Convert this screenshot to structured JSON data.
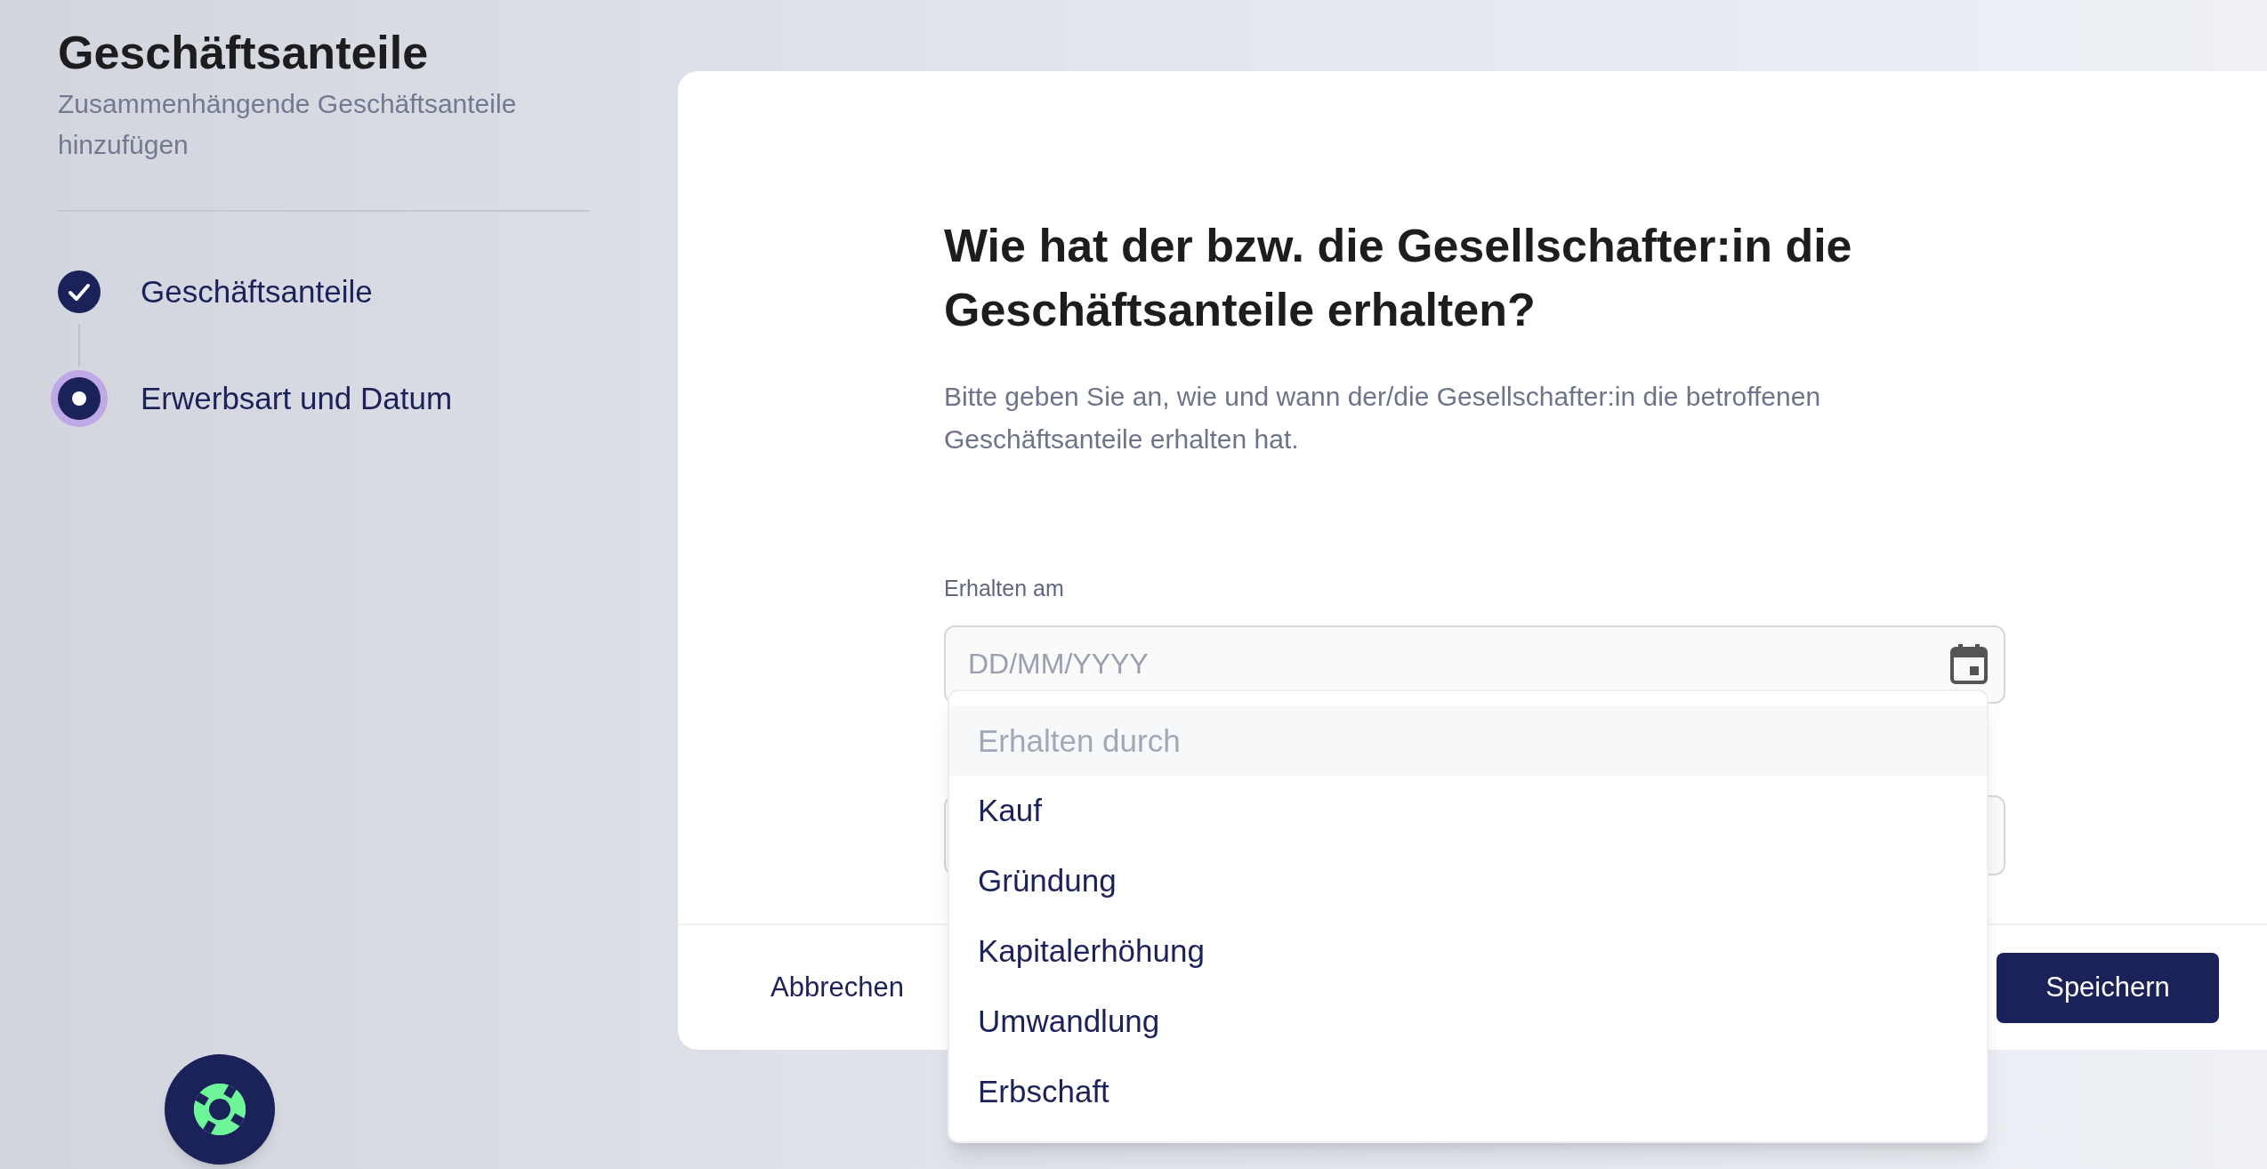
{
  "sidebar": {
    "title": "Geschäftsanteile",
    "subtitle": "Zusammenhängende Geschäftsanteile hinzufügen",
    "steps": [
      {
        "label": "Geschäftsanteile",
        "kind": "done"
      },
      {
        "label": "Erwerbsart und Datum",
        "kind": "current"
      }
    ]
  },
  "form": {
    "heading": "Wie hat der bzw. die Gesellschafter:in die Geschäftsanteile erhalten?",
    "description": "Bitte geben Sie an, wie und wann der/die Gesellschafter:in die betroffenen Geschäftsanteile erhalten hat.",
    "date_field": {
      "label": "Erhalten am",
      "placeholder": "DD/MM/YYYY"
    },
    "dropdown": {
      "placeholder": "Erhalten durch",
      "options": [
        "Kauf",
        "Gründung",
        "Kapitalerhöhung",
        "Umwandlung",
        "Erbschaft"
      ]
    }
  },
  "footer": {
    "cancel": "Abbrechen",
    "save": "Speichern"
  }
}
